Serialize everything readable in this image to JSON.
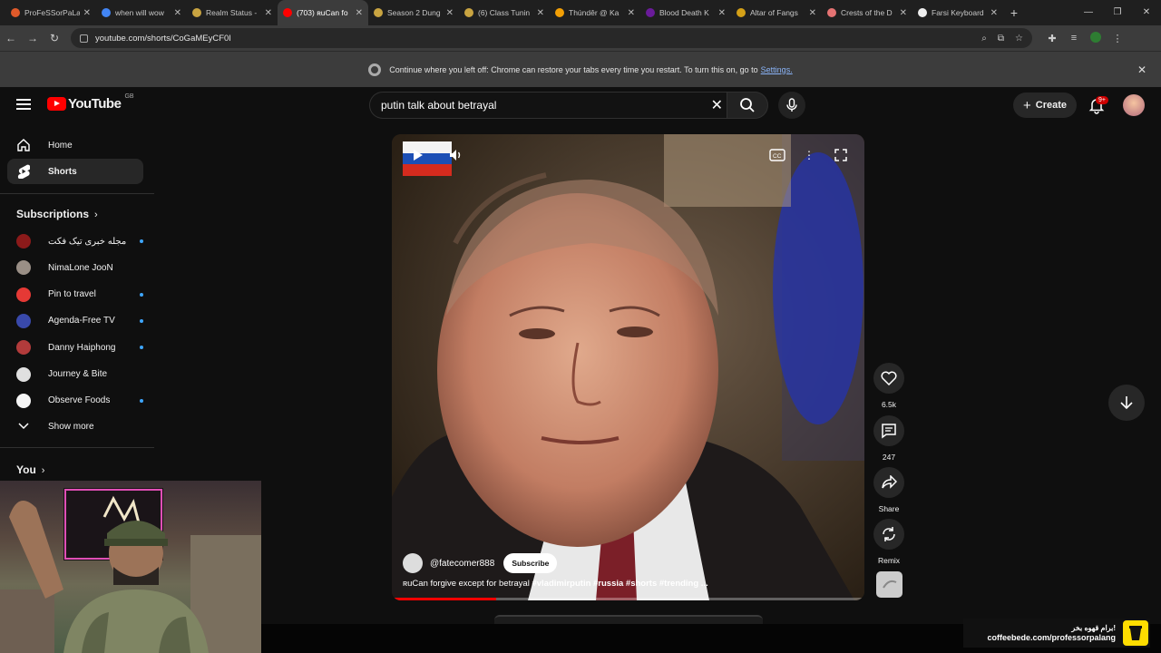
{
  "browser": {
    "tabs": [
      {
        "label": "ProFeSSorPaLa",
        "color": "#e05a2a"
      },
      {
        "label": "when will wow",
        "color": "#4285f4"
      },
      {
        "label": "Realm Status -",
        "color": "#c9a441"
      },
      {
        "label": "(703) ʀuCan fo",
        "color": "#ff0000",
        "active": true
      },
      {
        "label": "Season 2 Dung",
        "color": "#c9a441"
      },
      {
        "label": "(6) Class Tunin",
        "color": "#c9a441"
      },
      {
        "label": "Thúndêr @ Ka",
        "color": "#f29f05"
      },
      {
        "label": "Blood Death K",
        "color": "#6a1b9a"
      },
      {
        "label": "Altar of Fangs",
        "color": "#d4a017"
      },
      {
        "label": "Crests of the D",
        "color": "#e57373"
      },
      {
        "label": "Farsi Keyboard",
        "color": "#eeeeee"
      }
    ],
    "url": "youtube.com/shorts/CoGaMEyCF0I",
    "infobar": {
      "message": "Continue where you left off: Chrome can restore your tabs every time you restart. To turn this on, go to",
      "link": "Settings."
    }
  },
  "header": {
    "logo_text": "YouTube",
    "country_code": "GB",
    "search_value": "putin talk about betrayal",
    "create_label": "Create",
    "notif_badge": "9+"
  },
  "sidebar": {
    "nav": [
      {
        "label": "Home",
        "icon": "home-icon"
      },
      {
        "label": "Shorts",
        "icon": "shorts-icon",
        "selected": true
      }
    ],
    "subscriptions_title": "Subscriptions",
    "subscriptions": [
      {
        "name": "مجله خبری تیک فکت",
        "color": "#8b1a1a",
        "new": true
      },
      {
        "name": "NimaLone JooN",
        "color": "#9a8f86",
        "new": false
      },
      {
        "name": "Pin to travel",
        "color": "#e53935",
        "new": true
      },
      {
        "name": "Agenda-Free TV",
        "color": "#3949ab",
        "new": true
      },
      {
        "name": "Danny Haiphong",
        "color": "#b23b3b",
        "new": true
      },
      {
        "name": "Journey & Bite",
        "color": "#e0e0e0",
        "new": false
      },
      {
        "name": "Observe Foods",
        "color": "#f5f5f5",
        "new": true
      }
    ],
    "show_more": "Show more",
    "you_title": "You"
  },
  "short": {
    "channel_handle": "@fatecomer888",
    "subscribe_label": "Subscribe",
    "caption_text": "ʀuCan forgive except for betrayal",
    "caption_tags": "#vladimirputin #russia #shorts #trending ...",
    "progress": 0.22
  },
  "actions": {
    "likes": "6.5k",
    "comments": "247",
    "share": "Share",
    "remix": "Remix"
  },
  "coffee_banner": {
    "farsi": "برام قهوه بخر!",
    "url": "coffeebede.com/professorpalang"
  }
}
